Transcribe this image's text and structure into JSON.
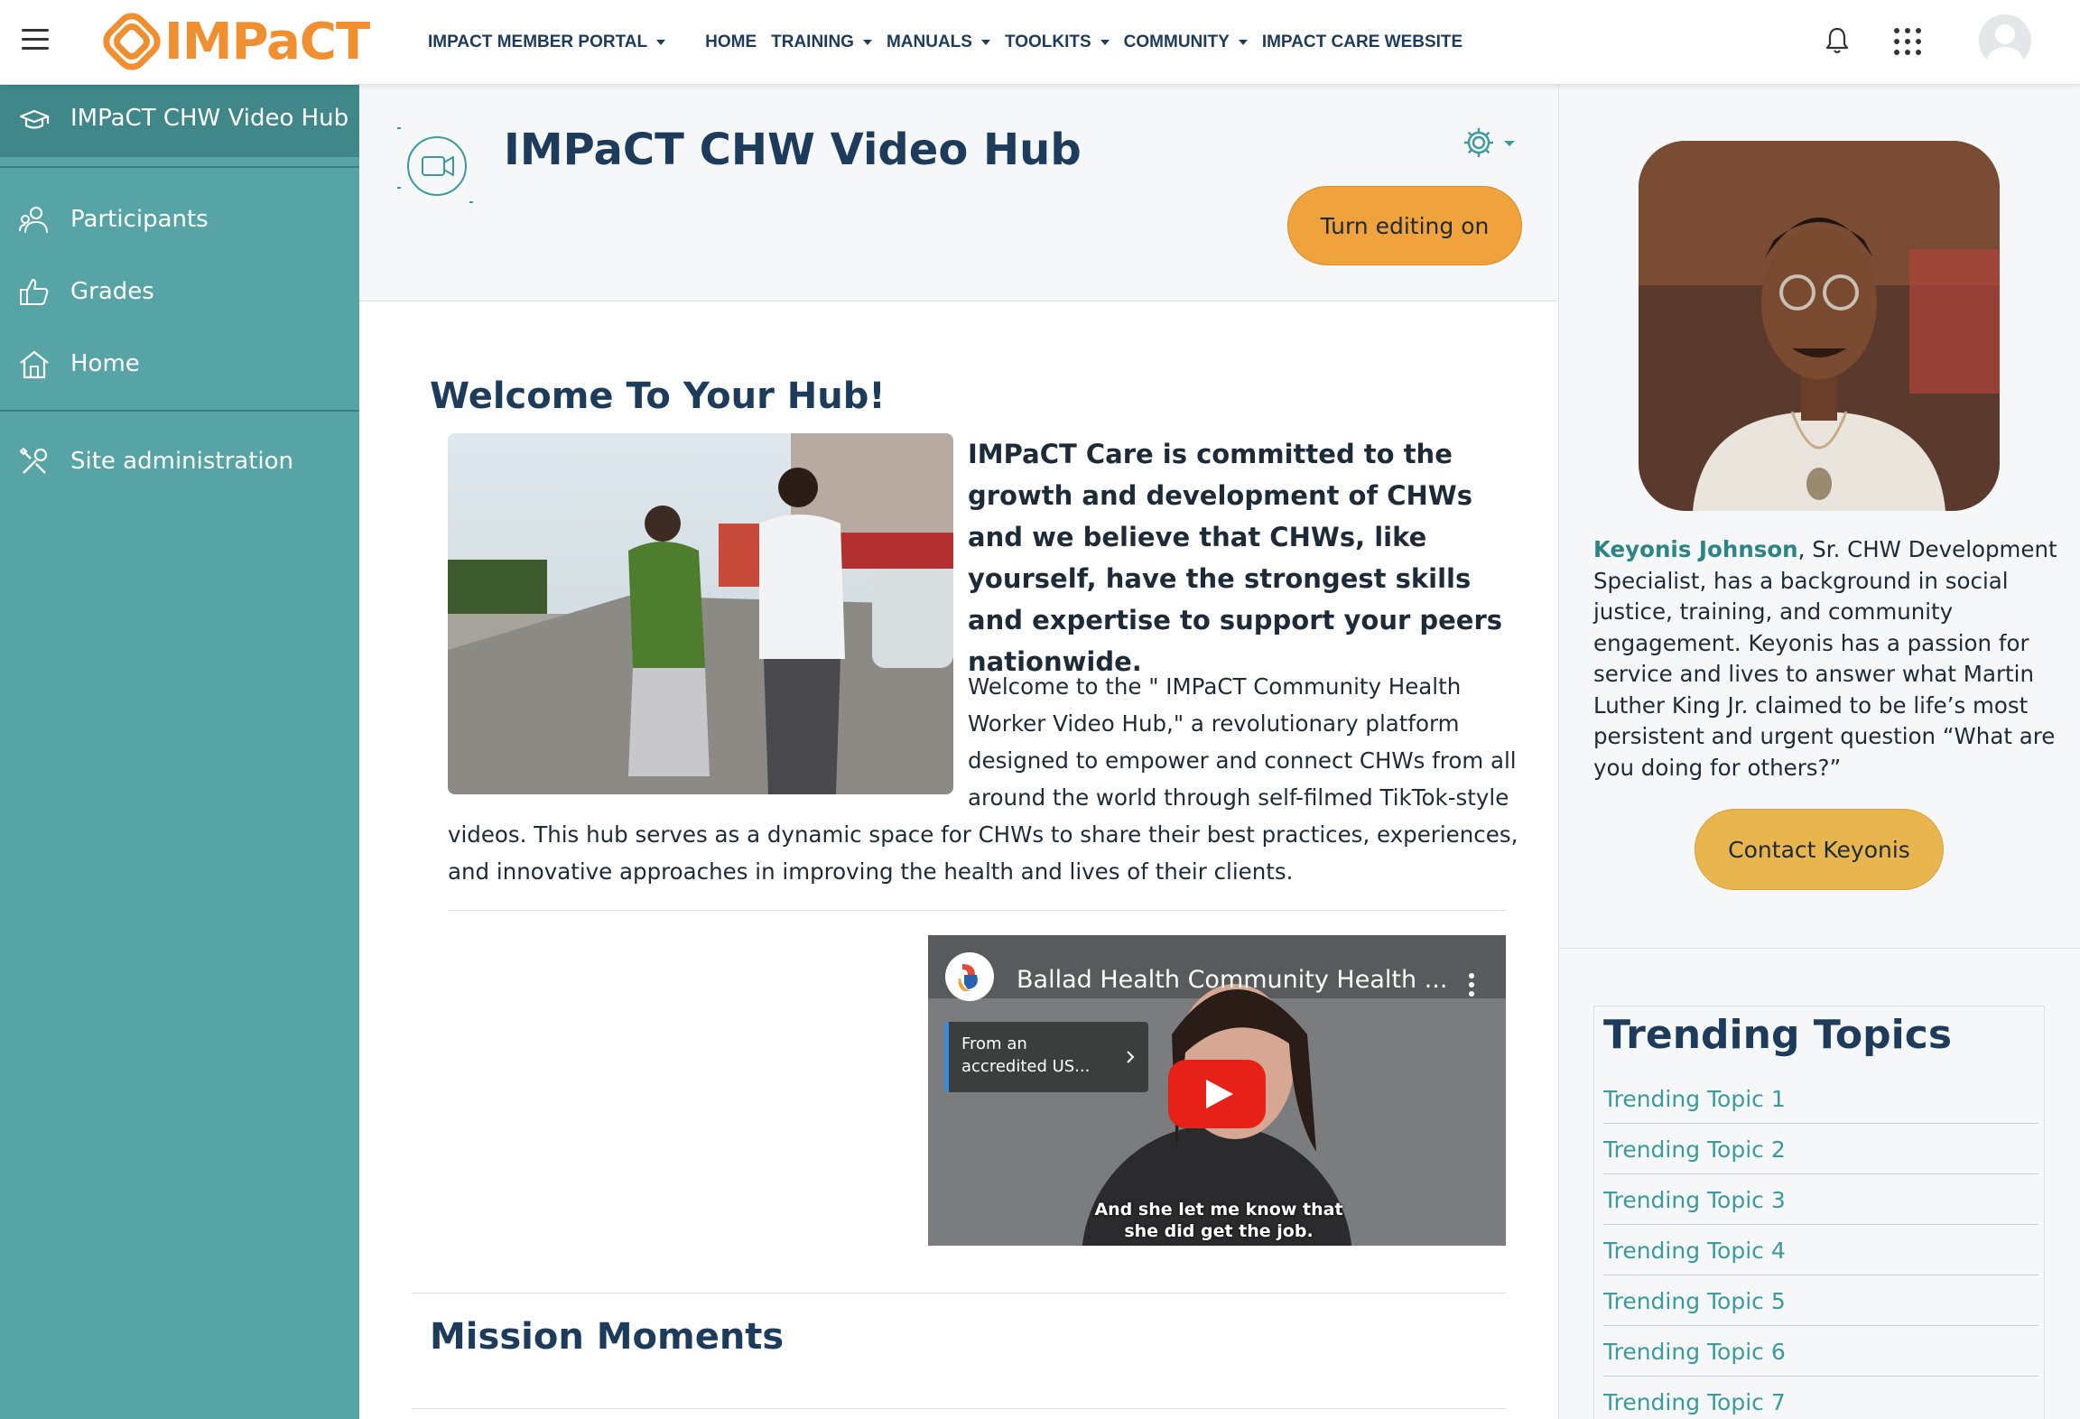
{
  "topbar": {
    "logo_text": "IMPaCT",
    "nav": [
      {
        "label": "IMPACT MEMBER PORTAL",
        "has_caret": true
      },
      {
        "label": "HOME",
        "has_caret": false
      },
      {
        "label": "TRAINING",
        "has_caret": true
      },
      {
        "label": "MANUALS",
        "has_caret": true
      },
      {
        "label": "TOOLKITS",
        "has_caret": true
      },
      {
        "label": "COMMUNITY",
        "has_caret": true
      },
      {
        "label": "IMPACT CARE WEBSITE",
        "has_caret": false
      }
    ],
    "icons": [
      "hamburger-icon",
      "bell-icon",
      "apps-grid-icon",
      "user-avatar"
    ]
  },
  "drawer": {
    "items": [
      {
        "label": "IMPaCT CHW Video Hub",
        "icon": "graduation-cap-icon",
        "active": true
      },
      {
        "label": "Participants",
        "icon": "users-icon"
      },
      {
        "label": "Grades",
        "icon": "thumbs-up-icon"
      },
      {
        "label": "Home",
        "icon": "home-icon"
      },
      {
        "label": "Site administration",
        "icon": "wrench-icon"
      }
    ]
  },
  "header": {
    "title": "IMPaCT CHW Video Hub",
    "edit_button": "Turn editing on"
  },
  "main": {
    "welcome_heading": "Welcome To Your Hub!",
    "intro_bold": "IMPaCT Care is committed to the growth and development of CHWs and we believe that CHWs, like yourself, have the strongest skills and expertise to support your peers nationwide.",
    "intro_text_a": "Welcome to the \" IMPaCT Community Health Worker Video Hub,\" a revolutionary platform designed to empower and connect CHWs from all around the world through self-filmed TikTok-style",
    "intro_text_b": "videos. This hub serves as a dynamic space for CHWs to share their best practices, experiences, and innovative approaches in improving the health and lives of their clients.",
    "video": {
      "title": "Ballad Health Community Health ...",
      "chip_line1": "From an",
      "chip_line2": "accredited US...",
      "caption_line1": "And she let me know that",
      "caption_line2": "she did get the job."
    },
    "mission_heading": "Mission Moments"
  },
  "right": {
    "bio_name": "Keyonis Johnson",
    "bio_text": ", Sr. CHW Development Specialist, has a background in social justice, training, and community engagement. Keyonis has a passion for service and lives to answer what Martin Luther King Jr. claimed to be life’s most persistent and urgent question “What are you doing for others?”",
    "contact_button": "Contact Keyonis",
    "trending_title": "Trending Topics",
    "trending_items": [
      "Trending Topic 1",
      "Trending Topic 2",
      "Trending Topic 3",
      "Trending Topic 4",
      "Trending Topic 5",
      "Trending Topic 6",
      "Trending Topic 7"
    ]
  },
  "colors": {
    "brand_orange": "#ef8f2f",
    "drawer_teal": "#57a4a6",
    "heading_navy": "#1d3b5a",
    "link_teal": "#3b9a9d"
  }
}
